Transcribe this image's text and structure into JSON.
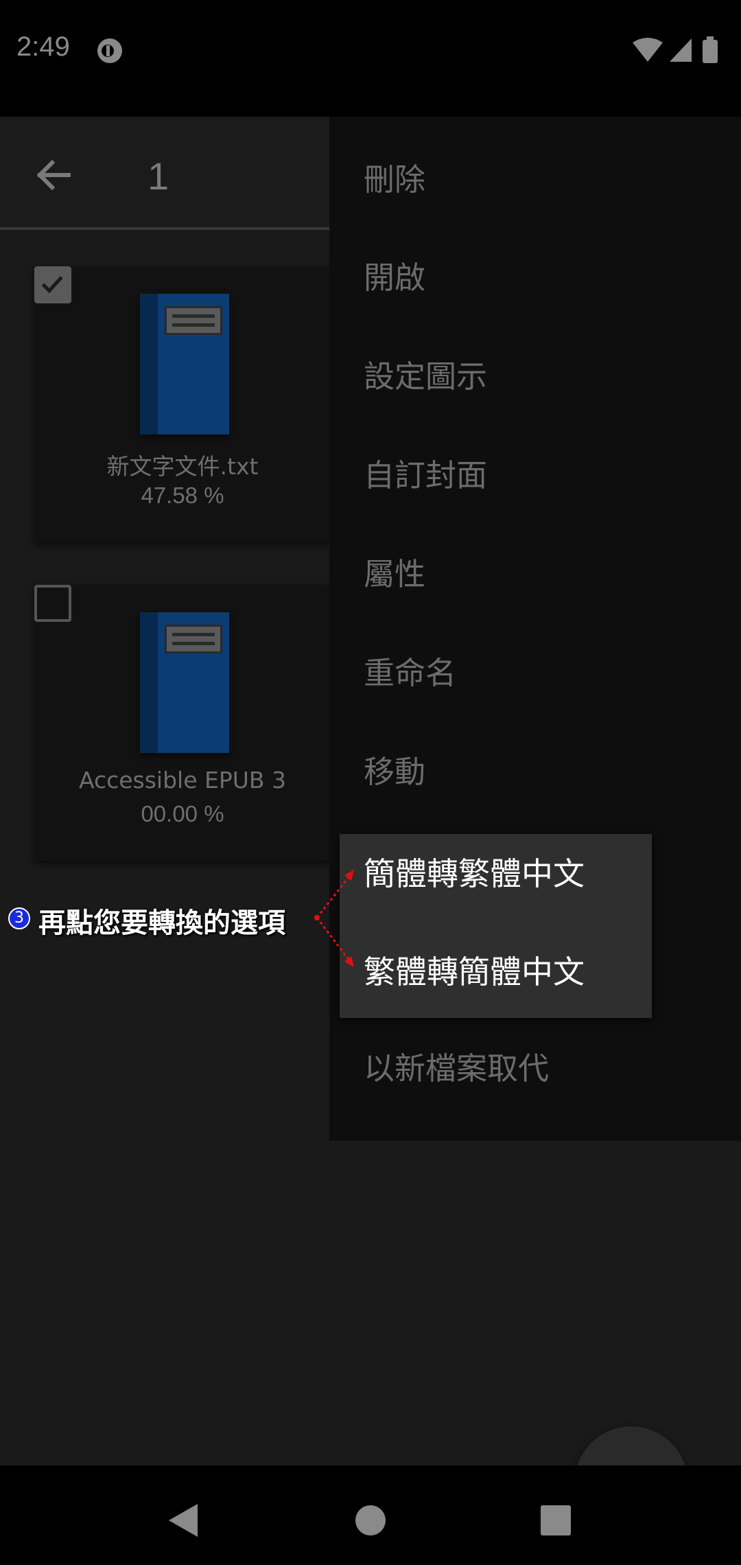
{
  "status_bar": {
    "time": "2:49"
  },
  "toolbar": {
    "selection_count": "1"
  },
  "books": [
    {
      "title": "新文字文件.txt",
      "progress": "47.58 %",
      "checked": true
    },
    {
      "title": "Accessible EPUB 3",
      "progress": "00.00 %",
      "checked": false
    }
  ],
  "menu": {
    "items": [
      "刪除",
      "開啟",
      "設定圖示",
      "自訂封面",
      "屬性",
      "重命名",
      "移動"
    ],
    "last_item": "以新檔案取代"
  },
  "submenu": {
    "items": [
      "簡體轉繁體中文",
      "繁體轉簡體中文"
    ]
  },
  "annotation": {
    "badge": "3",
    "text": "再點您要轉換的選項"
  }
}
